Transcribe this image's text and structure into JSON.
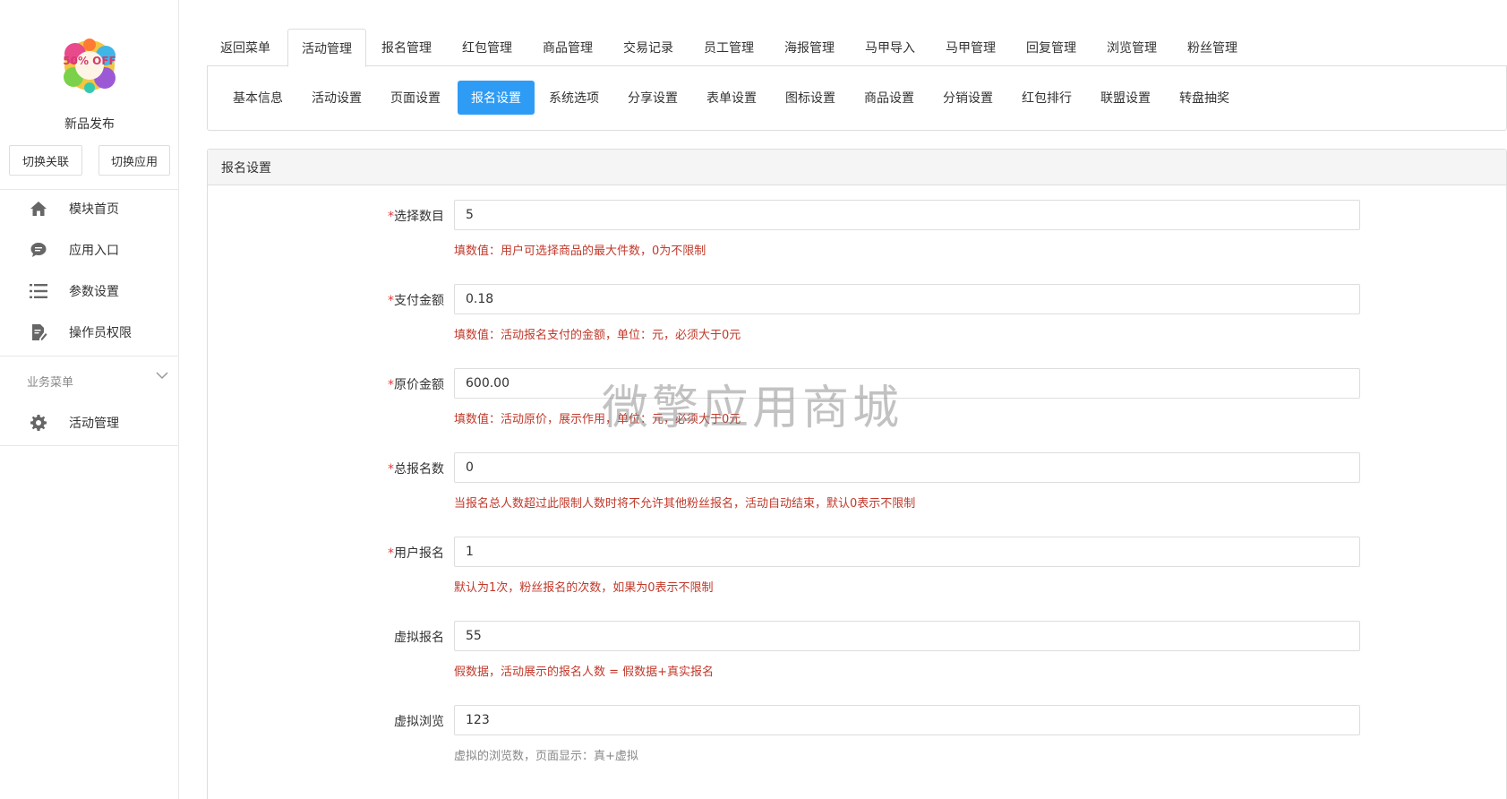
{
  "sidebar": {
    "app_name": "新品发布",
    "logo_text": "50% OFF",
    "switch_link_label": "切换关联",
    "switch_app_label": "切换应用",
    "items": [
      {
        "label": "模块首页",
        "icon": "home-icon"
      },
      {
        "label": "应用入口",
        "icon": "chat-icon"
      },
      {
        "label": "参数设置",
        "icon": "list-icon"
      },
      {
        "label": "操作员权限",
        "icon": "edit-doc-icon"
      }
    ],
    "section_label": "业务菜单",
    "section_items": [
      {
        "label": "活动管理",
        "icon": "gear-icon"
      }
    ]
  },
  "top_tabs": [
    "返回菜单",
    "活动管理",
    "报名管理",
    "红包管理",
    "商品管理",
    "交易记录",
    "员工管理",
    "海报管理",
    "马甲导入",
    "马甲管理",
    "回复管理",
    "浏览管理",
    "粉丝管理"
  ],
  "top_tab_active": "活动管理",
  "sub_tabs": [
    "基本信息",
    "活动设置",
    "页面设置",
    "报名设置",
    "系统选项",
    "分享设置",
    "表单设置",
    "图标设置",
    "商品设置",
    "分销设置",
    "红包排行",
    "联盟设置",
    "转盘抽奖"
  ],
  "sub_tab_active": "报名设置",
  "panel": {
    "title": "报名设置",
    "fields": [
      {
        "label": "选择数目",
        "required": true,
        "value": "5",
        "help": "填数值：用户可选择商品的最大件数，0为不限制",
        "help_color": "red"
      },
      {
        "label": "支付金额",
        "required": true,
        "value": "0.18",
        "help": "填数值：活动报名支付的金额，单位：元，必须大于0元",
        "help_color": "red"
      },
      {
        "label": "原价金额",
        "required": true,
        "value": "600.00",
        "help": "填数值：活动原价，展示作用，单位：元，必须大于0元",
        "help_color": "red"
      },
      {
        "label": "总报名数",
        "required": true,
        "value": "0",
        "help": "当报名总人数超过此限制人数时将不允许其他粉丝报名，活动自动结束，默认0表示不限制",
        "help_color": "red"
      },
      {
        "label": "用户报名",
        "required": true,
        "value": "1",
        "help": "默认为1次，粉丝报名的次数，如果为0表示不限制",
        "help_color": "red"
      },
      {
        "label": "虚拟报名",
        "required": false,
        "value": "55",
        "help": "假数据，活动展示的报名人数 = 假数据+真实报名",
        "help_color": "red"
      },
      {
        "label": "虚拟浏览",
        "required": false,
        "value": "123",
        "help": "虚拟的浏览数，页面显示：真+虚拟",
        "help_color": "gray"
      }
    ]
  },
  "watermark": "微擎应用商城",
  "colors": {
    "accent": "#2e9cf5",
    "help_red": "#c0392b",
    "required": "#e4393c"
  }
}
